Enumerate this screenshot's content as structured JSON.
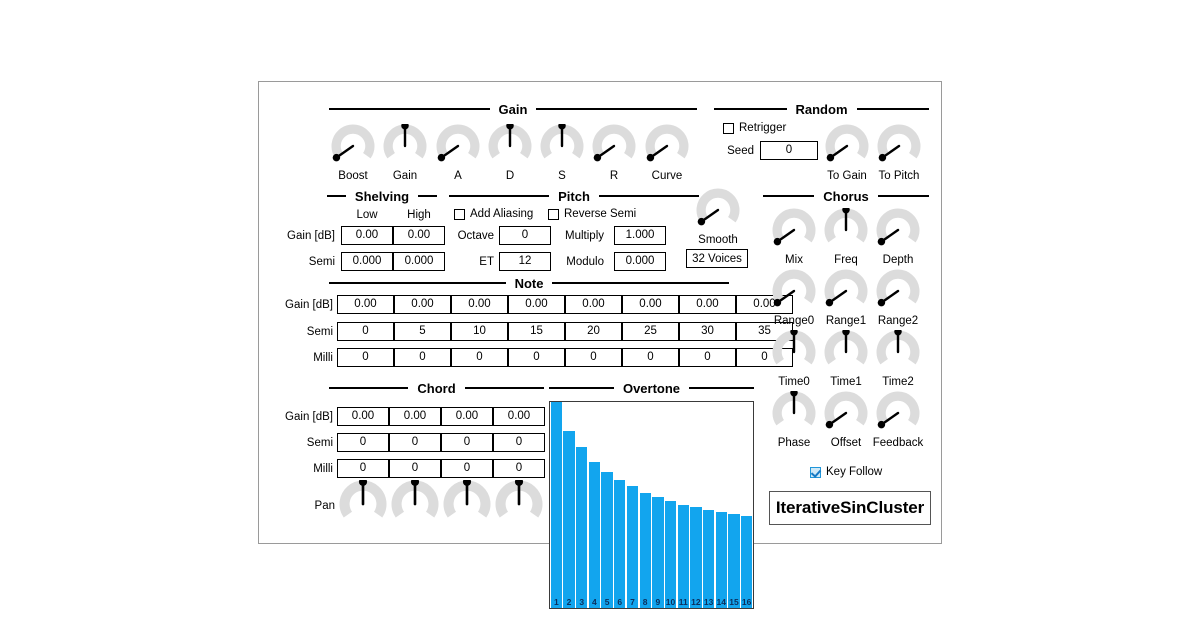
{
  "plugin": {
    "name": "IterativeSinCluster",
    "voices_button": "32 Voices"
  },
  "gain": {
    "title": "Gain",
    "knobs": [
      {
        "label": "Boost",
        "angle": -125
      },
      {
        "label": "Gain",
        "angle": 0
      },
      {
        "label": "A",
        "angle": -125
      },
      {
        "label": "D",
        "angle": 0
      },
      {
        "label": "S",
        "angle": 0
      },
      {
        "label": "R",
        "angle": -125
      },
      {
        "label": "Curve",
        "angle": -125
      }
    ]
  },
  "random": {
    "title": "Random",
    "retrigger": {
      "label": "Retrigger",
      "checked": false
    },
    "seed": {
      "label": "Seed",
      "value": "0"
    },
    "knobs": [
      {
        "label": "To Gain",
        "angle": -125
      },
      {
        "label": "To Pitch",
        "angle": -125
      }
    ]
  },
  "shelving": {
    "title": "Shelving",
    "columns": [
      "Low",
      "High"
    ],
    "rows": [
      {
        "label": "Gain [dB]",
        "values": [
          "0.00",
          "0.00"
        ]
      },
      {
        "label": "Semi",
        "values": [
          "0.000",
          "0.000"
        ]
      }
    ]
  },
  "pitch": {
    "title": "Pitch",
    "add_aliasing": {
      "label": "Add Aliasing",
      "checked": false
    },
    "reverse_semi": {
      "label": "Reverse Semi",
      "checked": false
    },
    "fields": [
      {
        "label": "Octave",
        "value": "0"
      },
      {
        "label": "Multiply",
        "value": "1.000"
      },
      {
        "label": "ET",
        "value": "12"
      },
      {
        "label": "Modulo",
        "value": "0.000"
      }
    ]
  },
  "smooth": {
    "label": "Smooth",
    "angle": -125
  },
  "note": {
    "title": "Note",
    "rows": [
      {
        "label": "Gain [dB]",
        "values": [
          "0.00",
          "0.00",
          "0.00",
          "0.00",
          "0.00",
          "0.00",
          "0.00",
          "0.00"
        ]
      },
      {
        "label": "Semi",
        "values": [
          "0",
          "5",
          "10",
          "15",
          "20",
          "25",
          "30",
          "35"
        ]
      },
      {
        "label": "Milli",
        "values": [
          "0",
          "0",
          "0",
          "0",
          "0",
          "0",
          "0",
          "0"
        ]
      }
    ]
  },
  "chord": {
    "title": "Chord",
    "rows": [
      {
        "label": "Gain [dB]",
        "values": [
          "0.00",
          "0.00",
          "0.00",
          "0.00"
        ]
      },
      {
        "label": "Semi",
        "values": [
          "0",
          "0",
          "0",
          "0"
        ]
      },
      {
        "label": "Milli",
        "values": [
          "0",
          "0",
          "0",
          "0"
        ]
      }
    ],
    "pan": {
      "label": "Pan",
      "knobs": [
        {
          "angle": 0
        },
        {
          "angle": 0
        },
        {
          "angle": 0
        },
        {
          "angle": 0
        }
      ]
    }
  },
  "overtone": {
    "title": "Overtone"
  },
  "chart_data": {
    "type": "bar",
    "title": "Overtone",
    "categories": [
      "1",
      "2",
      "3",
      "4",
      "5",
      "6",
      "7",
      "8",
      "9",
      "10",
      "11",
      "12",
      "13",
      "14",
      "15",
      "16"
    ],
    "values": [
      100,
      86,
      78,
      71,
      66,
      62,
      59,
      56,
      54,
      52,
      50,
      49,
      47.5,
      46.5,
      45.5,
      44.5
    ],
    "xlabel": "",
    "ylabel": "",
    "ylim": [
      0,
      100
    ],
    "grid": false,
    "legend": "none",
    "bar_color": "#12a5ee"
  },
  "chorus": {
    "title": "Chorus",
    "knobs": [
      {
        "label": "Mix",
        "angle": -125
      },
      {
        "label": "Freq",
        "angle": 0
      },
      {
        "label": "Depth",
        "angle": -125
      },
      {
        "label": "Range0",
        "angle": -125
      },
      {
        "label": "Range1",
        "angle": -125
      },
      {
        "label": "Range2",
        "angle": -125
      },
      {
        "label": "Time0",
        "angle": 0
      },
      {
        "label": "Time1",
        "angle": 0
      },
      {
        "label": "Time2",
        "angle": 0
      },
      {
        "label": "Phase",
        "angle": 0
      },
      {
        "label": "Offset",
        "angle": -125
      },
      {
        "label": "Feedback",
        "angle": -125
      }
    ],
    "key_follow": {
      "label": "Key Follow",
      "checked": true
    }
  }
}
